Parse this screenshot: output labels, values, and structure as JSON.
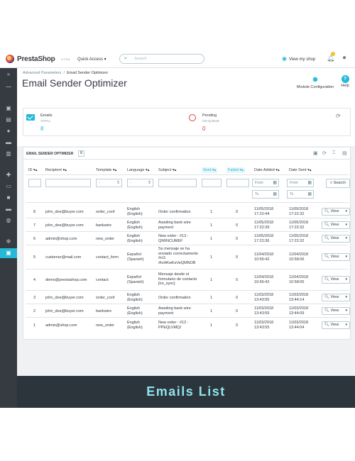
{
  "header": {
    "brand": "PrestaShop",
    "version": "1.7.3.0",
    "quick_access": "Quick Access ▾",
    "search_placeholder": "Search",
    "view_shop": "View my shop",
    "notification_count": "7"
  },
  "sidebar": {
    "icons": [
      "collapse-icon",
      "dashboard-icon",
      "orders-icon",
      "catalog-icon",
      "customers-icon",
      "messages-icon",
      "stats-icon",
      "modules-icon",
      "design-icon",
      "shipping-icon",
      "payment-icon",
      "international-icon",
      "settings-icon",
      "advanced-icon"
    ],
    "active": "advanced-icon"
  },
  "breadcrumb": [
    "Advanced Parameters",
    "/",
    "Email Sender Optimizer"
  ],
  "page_title": "Email Sender Optimizer",
  "toolbar": {
    "module_configuration": "Module Configuration",
    "help": "Help"
  },
  "kpi": {
    "emails_label": "Emails",
    "emails_sub": "TOTAL",
    "emails_value": "8",
    "pending_label": "Pending",
    "pending_sub": "ON QUEUE",
    "pending_value": "0"
  },
  "list": {
    "title": "EMAIL SENDER OPTIMIZER",
    "count": "8",
    "columns": [
      "ID ▾▴",
      "Recipient ▾▴",
      "Template ▾▴",
      "Language ▾▴",
      "Subject ▾▴",
      "Sent ▾▴",
      "Failed ▾▴",
      "Date Added ▾▴",
      "Date Sent ▾▴"
    ],
    "filter": {
      "template_select": "-",
      "language_select": "-",
      "from": "From",
      "to": "To",
      "search_button": "Search"
    },
    "view_label": "View",
    "rows": [
      {
        "id": "8",
        "recipient": "john_doe@buyer.com",
        "template": "order_conf",
        "language": "English (English)",
        "subject": "Order confirmation",
        "sent": "1",
        "failed": "0",
        "added": "11/05/2018 17:22:44",
        "sent_date": "11/05/2018 17:22:32"
      },
      {
        "id": "7",
        "recipient": "john_doe@buyer.com",
        "template": "bankwire",
        "language": "English (English)",
        "subject": "Awaiting bank wire payment",
        "sent": "1",
        "failed": "0",
        "added": "11/05/2018 17:22:39",
        "sent_date": "11/05/2018 17:22:32"
      },
      {
        "id": "6",
        "recipient": "admin@shop.com",
        "template": "new_order",
        "language": "English (English)",
        "subject": "New order : #13 - QIWNCUMEF",
        "sent": "1",
        "failed": "0",
        "added": "11/05/2018 17:22:36",
        "sent_date": "11/05/2018 17:22:32"
      },
      {
        "id": "5",
        "recipient": "customer@mail.com",
        "template": "contact_form",
        "language": "Español (Spanish)",
        "subject": "Su mensaje se ha enviado correctamente #ct1 #tcHKwKsVeQMNOB",
        "sent": "1",
        "failed": "0",
        "added": "11/04/2018 10:56:42",
        "sent_date": "11/04/2018 10:58:06"
      },
      {
        "id": "4",
        "recipient": "demo@prestashop.com",
        "template": "contact",
        "language": "Español (Spanish)",
        "subject": "Mensaje desde el formulario de contacto [no_sync]",
        "sent": "1",
        "failed": "0",
        "added": "11/04/2018 10:56:42",
        "sent_date": "11/04/2018 10:58:05"
      },
      {
        "id": "3",
        "recipient": "john_doe@buyer.com",
        "template": "order_conf",
        "language": "English (English)",
        "subject": "Order confirmation",
        "sent": "1",
        "failed": "0",
        "added": "11/03/2018 13:43:55",
        "sent_date": "11/03/2018 13:44:14"
      },
      {
        "id": "2",
        "recipient": "john_doe@buyer.com",
        "template": "bankwire",
        "language": "English (English)",
        "subject": "Awaiting bank wire payment",
        "sent": "1",
        "failed": "0",
        "added": "11/03/2018 13:43:55",
        "sent_date": "11/03/2018 13:44:09"
      },
      {
        "id": "1",
        "recipient": "admin@shop.com",
        "template": "new_order",
        "language": "English (English)",
        "subject": "New order : #12 - PPEQLVMQI",
        "sent": "1",
        "failed": "0",
        "added": "11/03/2018 13:43:55",
        "sent_date": "11/03/2018 13:44:04"
      }
    ]
  },
  "caption": "Emails List",
  "colors": {
    "accent": "#25b9d7",
    "sidebar": "#363a41",
    "caption_bg": "#2c353c",
    "caption_text": "#8fe3ee",
    "danger": "#e33c3c"
  }
}
